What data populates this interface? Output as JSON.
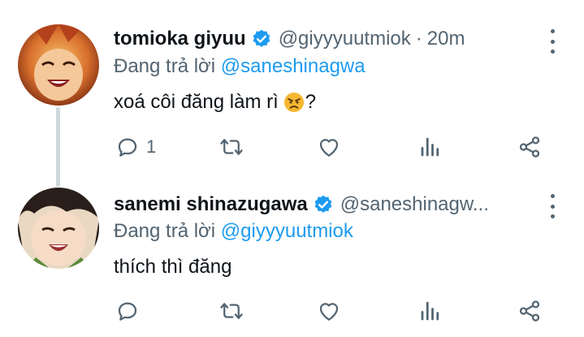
{
  "colors": {
    "link": "#1d9bf0",
    "secondary_text": "#536471",
    "thread_line": "#cfd9de"
  },
  "tweets": [
    {
      "display_name": "tomioka giyuu",
      "handle": "@giyyyuutmiok",
      "separator": "·",
      "time": "20m",
      "reply_prefix": "Đang trả lời",
      "reply_to": "@saneshinagwa",
      "text": "xoá côi đăng làm rì",
      "text_suffix": "?",
      "emoji": "angry-face-emoji",
      "reply_count": "1"
    },
    {
      "display_name": "sanemi shinazugawa",
      "handle": "@saneshinagw...",
      "reply_prefix": "Đang trả lời",
      "reply_to": "@giyyyuutmiok",
      "text": "thích thì đăng",
      "reply_count": ""
    }
  ]
}
